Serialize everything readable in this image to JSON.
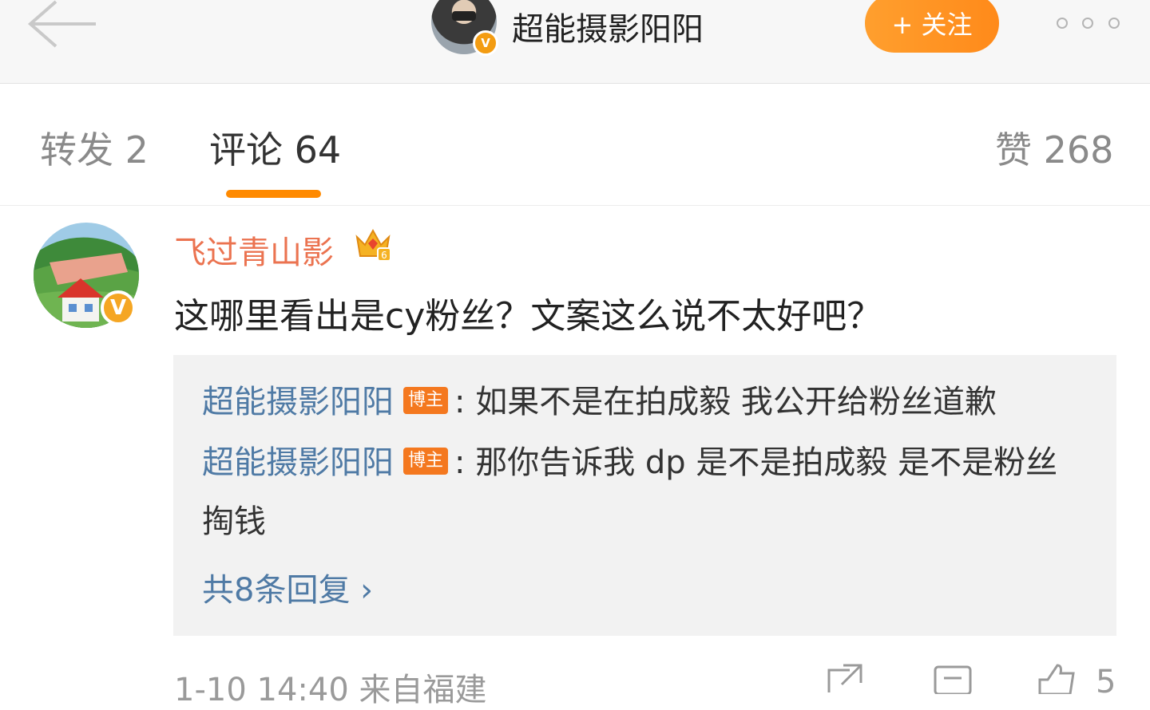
{
  "header": {
    "author_name": "超能摄影阳阳",
    "follow_label": "+ 关注",
    "verified_badge": "V",
    "icons": [
      "back-arrow-icon",
      "more-dots-icon"
    ]
  },
  "tabs": {
    "repost_label": "转发 2",
    "comment_label": "评论 64",
    "like_label": "赞 268",
    "active": "comment",
    "accent_color": "#ff8a00"
  },
  "comment": {
    "username": "飞过青山影",
    "username_color": "#eb7350",
    "verified_badge": "V",
    "level_badge": "6",
    "text": "这哪里看出是cy粉丝？文案这么说不太好吧？",
    "replies": [
      {
        "author": "超能摄影阳阳",
        "tag": "博主",
        "text": ": 如果不是在拍成毅 我公开给粉丝道歉"
      },
      {
        "author": "超能摄影阳阳",
        "tag": "博主",
        "text": ": 那你告诉我 dp 是不是拍成毅 是不是粉丝掏钱"
      }
    ],
    "more_replies_label": "共8条回复 ",
    "more_replies_arrow": "›",
    "meta": "1-10 14:40  来自福建",
    "like_count": "5"
  }
}
